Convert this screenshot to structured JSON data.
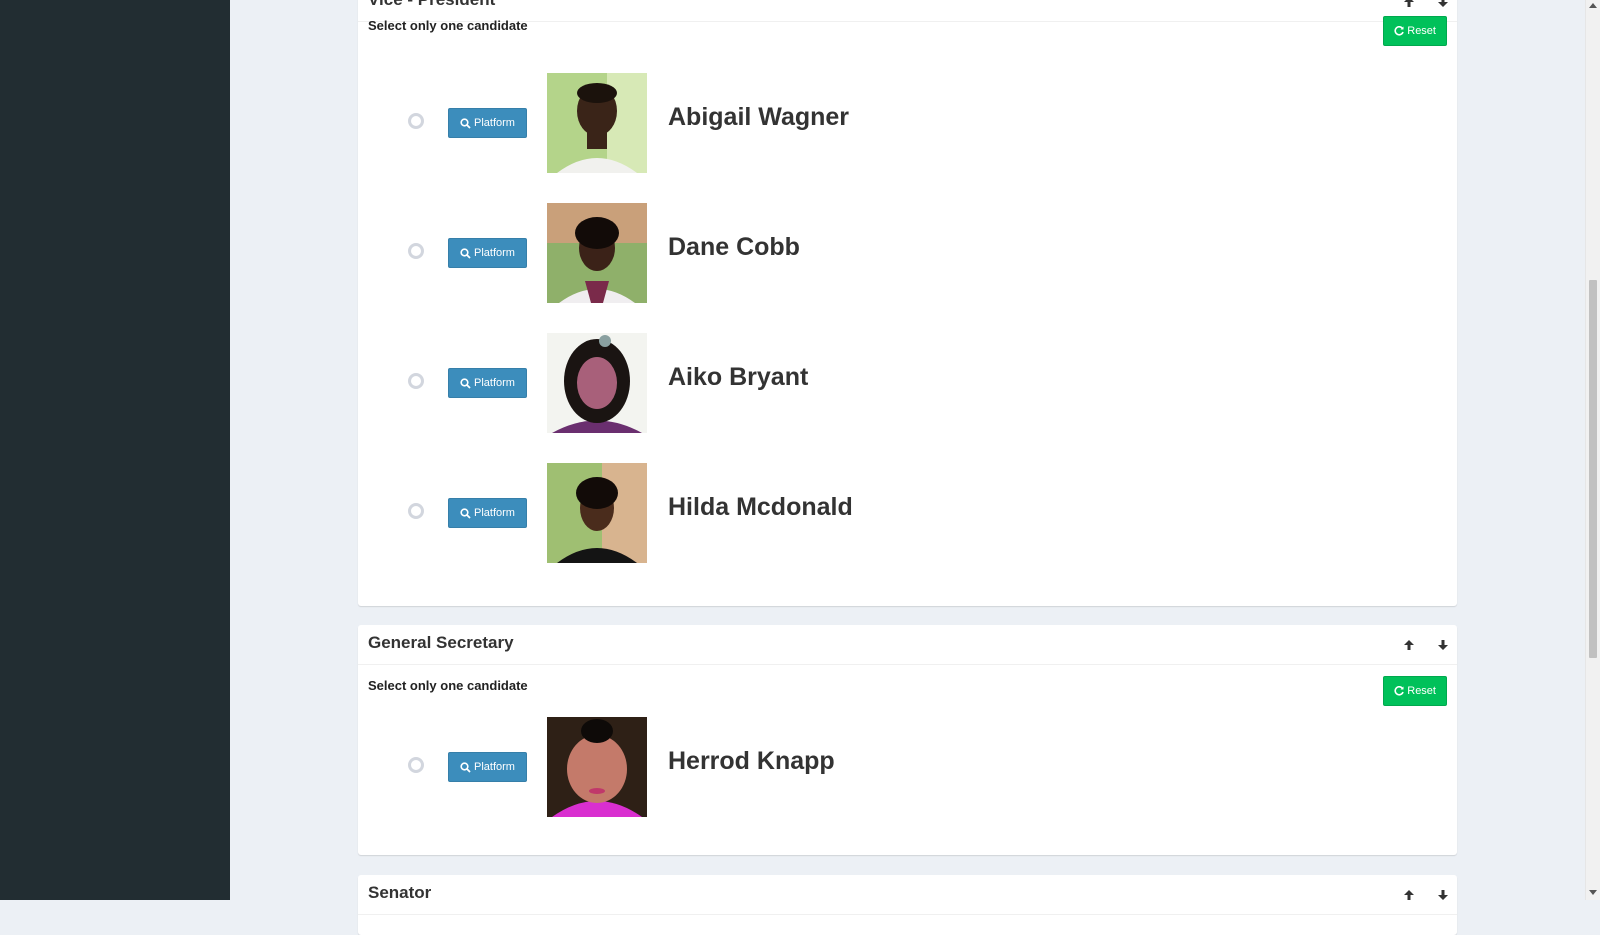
{
  "sections": [
    {
      "title": "Vice - President",
      "instruction": "Select only one candidate",
      "reset_label": "Reset",
      "candidates": [
        {
          "name": "Abigail Wagner",
          "platform_label": "Platform"
        },
        {
          "name": "Dane Cobb",
          "platform_label": "Platform"
        },
        {
          "name": "Aiko Bryant",
          "platform_label": "Platform"
        },
        {
          "name": "Hilda Mcdonald",
          "platform_label": "Platform"
        }
      ]
    },
    {
      "title": "General Secretary",
      "instruction": "Select only one candidate",
      "reset_label": "Reset",
      "candidates": [
        {
          "name": "Herrod Knapp",
          "platform_label": "Platform"
        }
      ]
    },
    {
      "title": "Senator"
    }
  ],
  "icons": {
    "move_up": "arrow-up-icon",
    "move_down": "arrow-down-icon",
    "reset": "refresh-icon",
    "platform": "search-icon"
  },
  "colors": {
    "sidebar": "#222d32",
    "background": "#ecf0f5",
    "reset_button": "#00c15a",
    "platform_button": "#3c8dbc"
  }
}
